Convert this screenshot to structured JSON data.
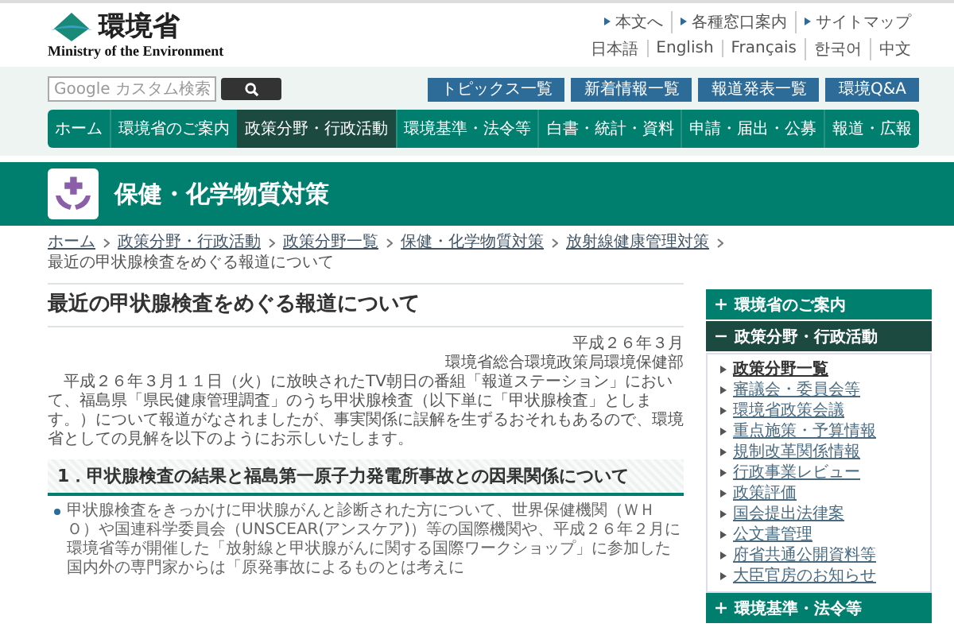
{
  "header": {
    "logo_name": "環境省",
    "logo_subtitle": "Ministry of the Environment",
    "utility_links": [
      "本文へ",
      "各種窓口案内",
      "サイトマップ"
    ],
    "languages": [
      "日本語",
      "English",
      "Français",
      "한국어",
      "中文"
    ]
  },
  "search": {
    "placeholder": "Google カスタム検索"
  },
  "quick_buttons": [
    "トピックス一覧",
    "新着情報一覧",
    "報道発表一覧",
    "環境Q&A"
  ],
  "nav": [
    {
      "label": "ホーム",
      "selected": false
    },
    {
      "label": "環境省のご案内",
      "selected": false
    },
    {
      "label": "政策分野・行政活動",
      "selected": true
    },
    {
      "label": "環境基準・法令等",
      "selected": false
    },
    {
      "label": "白書・統計・資料",
      "selected": false
    },
    {
      "label": "申請・届出・公募",
      "selected": false
    },
    {
      "label": "報道・広報",
      "selected": false
    }
  ],
  "banner": {
    "title": "保健・化学物質対策"
  },
  "breadcrumb": [
    {
      "label": "ホーム",
      "link": true
    },
    {
      "label": "政策分野・行政活動",
      "link": true
    },
    {
      "label": "政策分野一覧",
      "link": true
    },
    {
      "label": "保健・化学物質対策",
      "link": true
    },
    {
      "label": "放射線健康管理対策",
      "link": true
    },
    {
      "label": "最近の甲状腺検査をめぐる報道について",
      "link": false
    }
  ],
  "article": {
    "title": "最近の甲状腺検査をめぐる報道について",
    "date": "平成２６年３月",
    "author": "環境省総合環境政策局環境保健部",
    "intro": "平成２６年３月１１日（火）に放映されたTV朝日の番組「報道ステーション」において、福島県「県民健康管理調査」のうち甲状腺検査（以下単に「甲状腺検査」とします。）について報道がなされましたが、事実関係に誤解を生ずるおそれもあるので、環境省としての見解を以下のようにお示しいたします。",
    "section_heading": "1．甲状腺検査の結果と福島第一原子力発電所事故との因果関係について",
    "bullets": [
      "甲状腺検査をきっかけに甲状腺がんと診断された方について、世界保健機関（ＷＨＯ）や国連科学委員会（UNSCEAR(アンスケア)）等の国際機関や、平成２６年２月に環境省等が開催した「放射線と甲状腺がんに関する国際ワークショップ」に参加した国内外の専門家からは「原発事故によるものとは考えに"
    ]
  },
  "sidebar": {
    "sections": [
      {
        "label": "環境省のご案内",
        "expanded": false
      },
      {
        "label": "政策分野・行政活動",
        "expanded": true,
        "items": [
          {
            "label": "政策分野一覧",
            "selected": true
          },
          {
            "label": "審議会・委員会等",
            "selected": false
          },
          {
            "label": "環境省政策会議",
            "selected": false
          },
          {
            "label": "重点施策・予算情報",
            "selected": false
          },
          {
            "label": "規制改革関係情報",
            "selected": false
          },
          {
            "label": "行政事業レビュー",
            "selected": false
          },
          {
            "label": "政策評価",
            "selected": false
          },
          {
            "label": "国会提出法律案",
            "selected": false
          },
          {
            "label": "公文書管理",
            "selected": false
          },
          {
            "label": "府省共通公開資料等",
            "selected": false
          },
          {
            "label": "大臣官房のお知らせ",
            "selected": false
          }
        ]
      },
      {
        "label": "環境基準・法令等",
        "expanded": false
      }
    ]
  }
}
